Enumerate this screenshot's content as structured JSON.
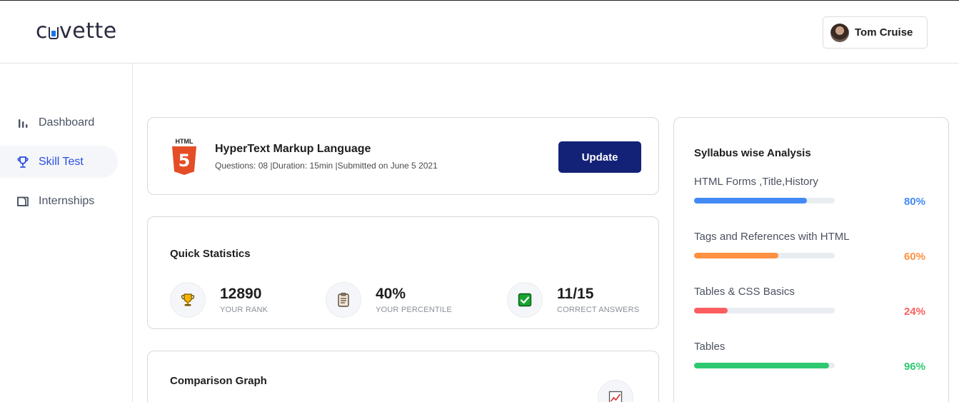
{
  "header": {
    "logo_text_pre": "c",
    "logo_text_post": "vette",
    "user_name": "Tom Cruise"
  },
  "sidebar": {
    "items": [
      {
        "label": "Dashboard",
        "icon": "bar-chart-icon",
        "active": false
      },
      {
        "label": "Skill Test",
        "icon": "trophy-icon",
        "active": true
      },
      {
        "label": "Internships",
        "icon": "folder-icon",
        "active": false
      }
    ]
  },
  "test_card": {
    "badge": "HTML",
    "badge_number": "5",
    "title": "HyperText Markup Language",
    "meta": "Questions: 08 |Duration: 15min |Submitted on June 5 2021",
    "update_label": "Update"
  },
  "quick_stats": {
    "title": "Quick Statistics",
    "items": [
      {
        "value": "12890",
        "label": "YOUR RANK",
        "icon": "trophy-icon"
      },
      {
        "value": "40%",
        "label": "YOUR PERCENTILE",
        "icon": "clipboard-icon"
      },
      {
        "value": "11/15",
        "label": "CORRECT ANSWERS",
        "icon": "check-box-icon"
      }
    ]
  },
  "comparison": {
    "title": "Comparison Graph",
    "icon": "chart-icon"
  },
  "syllabus": {
    "title": "Syllabus wise Analysis",
    "items": [
      {
        "label": "HTML Forms ,Title,History",
        "percent": 80,
        "percent_text": "80%",
        "color": "#438af6"
      },
      {
        "label": "Tags and References with HTML",
        "percent": 60,
        "percent_text": "60%",
        "color": "#ff9142"
      },
      {
        "label": "Tables & CSS Basics",
        "percent": 24,
        "percent_text": "24%",
        "color": "#fb5e5e"
      },
      {
        "label": "Tables",
        "percent": 96,
        "percent_text": "96%",
        "color": "#2ec971"
      }
    ]
  },
  "colors": {
    "accent": "#132277",
    "nav_active": "#2a4ee0"
  }
}
